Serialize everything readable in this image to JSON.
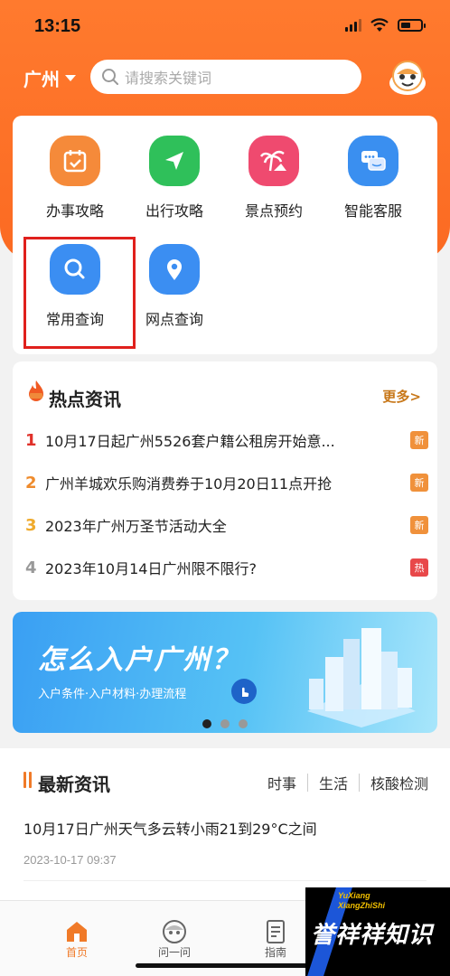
{
  "status_bar": {
    "time": "13:15"
  },
  "header": {
    "city": "广州",
    "search_placeholder": "请搜索关键词"
  },
  "services": [
    {
      "label": "办事攻略",
      "icon": "calendar-check-icon",
      "color": "#f58a3a"
    },
    {
      "label": "出行攻略",
      "icon": "navigation-arrow-icon",
      "color": "#2fc05a"
    },
    {
      "label": "景点预约",
      "icon": "palm-tree-icon",
      "color": "#ef4a6f"
    },
    {
      "label": "智能客服",
      "icon": "chat-bubbles-icon",
      "color": "#3a8ff0"
    },
    {
      "label": "常用查询",
      "icon": "search-icon",
      "color": "#3b8ef2"
    },
    {
      "label": "网点查询",
      "icon": "location-pin-icon",
      "color": "#3b8ef2"
    }
  ],
  "hot_news": {
    "title": "热点资讯",
    "more": "更多>",
    "items": [
      {
        "num": "1",
        "text": "10月17日起广州5526套户籍公租房开始意...",
        "tag": "新",
        "num_color": "#e0312a",
        "tag_color": "#f0913b"
      },
      {
        "num": "2",
        "text": "广州羊城欢乐购消费券于10月20日11点开抢",
        "tag": "新",
        "num_color": "#ef8b2c",
        "tag_color": "#f0913b"
      },
      {
        "num": "3",
        "text": "2023年广州万圣节活动大全",
        "tag": "新",
        "num_color": "#efaa2c",
        "tag_color": "#f0913b"
      },
      {
        "num": "4",
        "text": "2023年10月14日广州限不限行?",
        "tag": "热",
        "num_color": "#999999",
        "tag_color": "#e8484a"
      }
    ]
  },
  "banner": {
    "title": "怎么入户广州？",
    "subtitle": "入户条件·入户材料·办理流程"
  },
  "latest": {
    "title": "最新资讯",
    "tabs": [
      "时事",
      "生活",
      "核酸检测"
    ],
    "headline": "10月17日广州天气多云转小雨21到29°C之间",
    "date": "2023-10-17 09:37"
  },
  "tabbar": [
    {
      "label": "首页",
      "icon": "home-icon"
    },
    {
      "label": "问一问",
      "icon": "mascot-icon"
    },
    {
      "label": "指南",
      "icon": "document-icon"
    }
  ],
  "watermark": {
    "small_line1": "YuXiang",
    "small_line2": "XiangZhiShi",
    "main": "誉祥祥知识"
  }
}
